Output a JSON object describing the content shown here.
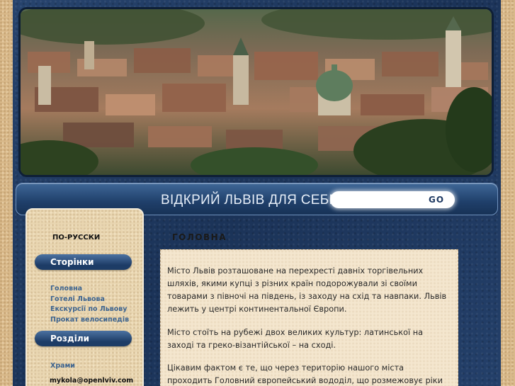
{
  "header": {
    "site_title": "ВІДКРИЙ ЛЬВІВ ДЛЯ СЕБЕ",
    "search": {
      "value": "",
      "button_label": "GO"
    }
  },
  "sidebar": {
    "language_link": "ПО-РУССКИ",
    "pages_heading": "Сторінки",
    "pages": [
      {
        "label": "Головна"
      },
      {
        "label": "Готелі Львова"
      },
      {
        "label": "Екскурсії по Львову"
      },
      {
        "label": "Прокат велосипедів"
      }
    ],
    "sections_heading": "Розділи",
    "sections": [
      {
        "label": "Храми"
      }
    ],
    "email": "mykola@openlviv.com"
  },
  "main": {
    "heading": "ГОЛОВНА",
    "paragraphs": [
      "Місто Львів розташоване на перехресті давніх торгівельних шляхів, якими купці з різних країн подорожували зі своїми товарами з півночі на південь, із заходу на схід та навпаки. Львів лежить у центрі континентальної Європи.",
      "Місто стоїть на рубежі двох великих культур: латинської на заході та греко-візантійської – на сході.",
      "Цікавим фактом є те, що через територію нашого міста проходить Головний європейський вододіл, що розмежовує ріки Чорного та"
    ]
  },
  "colors": {
    "navy_background": "#1f3a63",
    "sand": "#d9b98a",
    "link_blue": "#3d6490",
    "content_panel": "#f4e6ce"
  }
}
